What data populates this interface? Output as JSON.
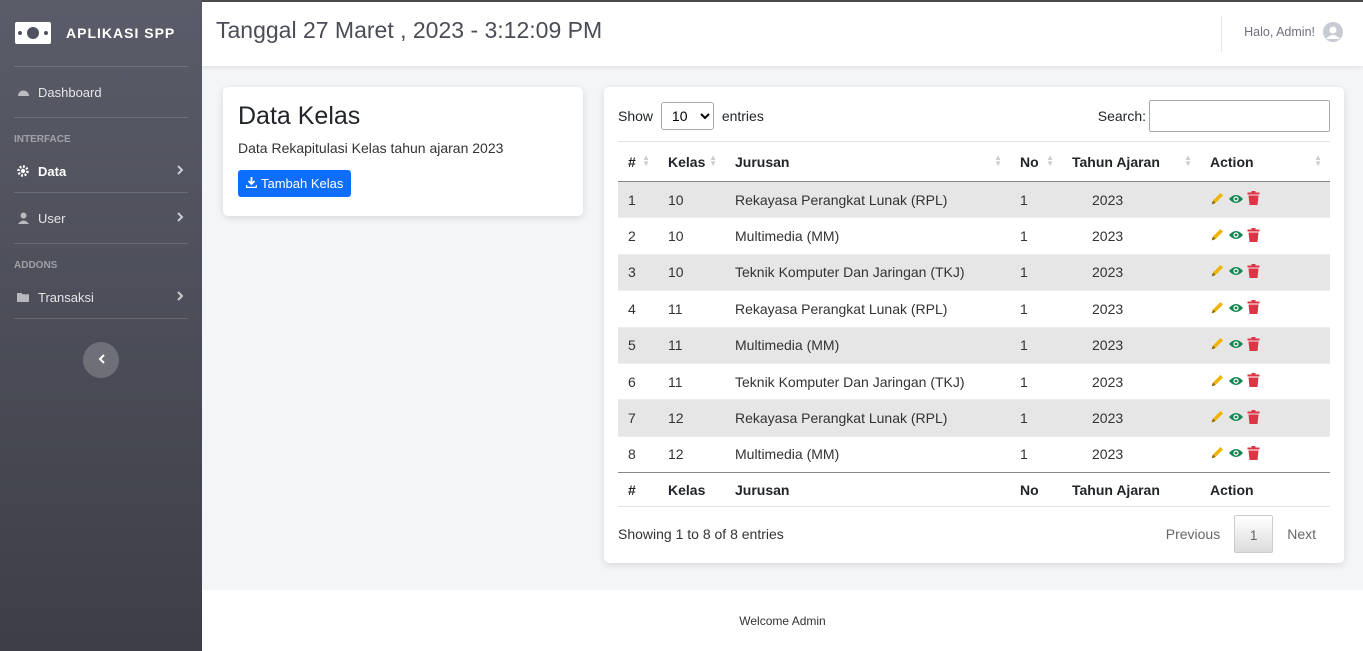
{
  "brand": {
    "name": "APLIKASI SPP",
    "icon": "money-bill-icon"
  },
  "sidebar": {
    "dashboard": "Dashboard",
    "heading_interface": "INTERFACE",
    "data": "Data",
    "user": "User",
    "heading_addons": "ADDONS",
    "transaksi": "Transaksi"
  },
  "topbar": {
    "title": "Tanggal 27 Maret , 2023 - 3:12:09 PM",
    "greeting": "Halo, Admin!"
  },
  "kelas_card": {
    "title": "Data Kelas",
    "subtitle": "Data Rekapitulasi Kelas tahun ajaran 2023",
    "add_button": "Tambah Kelas"
  },
  "table": {
    "show_label": "Show",
    "entries_label": "entries",
    "page_length": "10",
    "search_label": "Search:",
    "search_value": "",
    "columns": [
      "#",
      "Kelas",
      "Jurusan",
      "No",
      "Tahun Ajaran",
      "Action"
    ],
    "rows": [
      [
        "1",
        "10",
        "Rekayasa Perangkat Lunak (RPL)",
        "1",
        "2023"
      ],
      [
        "2",
        "10",
        "Multimedia (MM)",
        "1",
        "2023"
      ],
      [
        "3",
        "10",
        "Teknik Komputer Dan Jaringan (TKJ)",
        "1",
        "2023"
      ],
      [
        "4",
        "11",
        "Rekayasa Perangkat Lunak (RPL)",
        "1",
        "2023"
      ],
      [
        "5",
        "11",
        "Multimedia (MM)",
        "1",
        "2023"
      ],
      [
        "6",
        "11",
        "Teknik Komputer Dan Jaringan (TKJ)",
        "1",
        "2023"
      ],
      [
        "7",
        "12",
        "Rekayasa Perangkat Lunak (RPL)",
        "1",
        "2023"
      ],
      [
        "8",
        "12",
        "Multimedia (MM)",
        "1",
        "2023"
      ]
    ],
    "info": "Showing 1 to 8 of 8 entries",
    "previous": "Previous",
    "current_page": "1",
    "next": "Next"
  },
  "colors": {
    "edit": "#f0b400",
    "view": "#198754",
    "delete": "#dc3545",
    "primary": "#0d6efd"
  },
  "footer": {
    "text": "Welcome Admin"
  }
}
